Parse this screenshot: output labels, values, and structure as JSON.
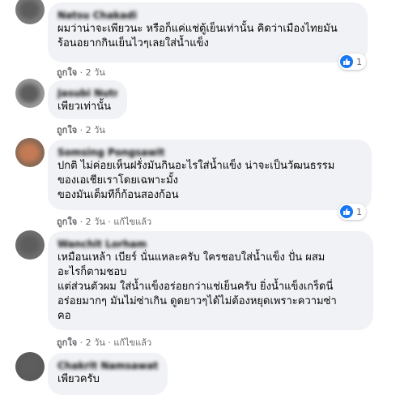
{
  "comments": [
    {
      "author": "Natsu Chakadi",
      "text": "ผมว่าน่าจะเพียวนะ หรือก็แค่แช่ตู้เย็นเท่านั้น คิดว่าเมืองไทยมัน\nร้อนอยากกินเย็นไวๆเลยใส่น้ำแข็ง",
      "like_label": "ถูกใจ",
      "time": "2 วัน",
      "reaction_count": "1"
    },
    {
      "author": "Jasubi Nutno",
      "text": "เพียวเท่านั้น",
      "like_label": "ถูกใจ",
      "time": "2 วัน"
    },
    {
      "author": "Somsing Pongsawit",
      "text": "ปกติ ไม่ค่อยเห็นฝรั่งมันกินอะไรใส่น้ำแข็ง น่าจะเป็นวัฒนธรรม\nของเอเชียเราโดยเฉพาะมั้ง\nของมันเต็มทีก็ก้อนสองก้อน",
      "like_label": "ถูกใจ",
      "time": "2 วัน",
      "edited": "แก้ไขแล้ว",
      "reaction_count": "1"
    },
    {
      "author": "Wanchit Lorham",
      "text": "เหมือนเหล้า เบียร์ นั่นแหละครับ ใครชอบใส่น้ำแข็ง ปั่น ผสม\nอะไรก็ตามชอบ\nแต่ส่วนตัวผม ใส่น้ำแข็งอร่อยกว่าแช่เย็นครับ ยิ่งน้ำแข็งเกร็ดนี่\nอร่อยมากๆ มันไม่ซ่าเกิน ดูดยาวๆได้ไม่ต้องหยุดเพราะความซ่า\nคอ",
      "like_label": "ถูกใจ",
      "time": "2 วัน",
      "edited": "แก้ไขแล้ว"
    },
    {
      "author": "Chakrit Namsawat",
      "text": "เพียวครับ"
    }
  ],
  "separator": "·",
  "like_icon": "thumbs-up-icon",
  "colors": {
    "bubble": "#f0f2f5",
    "meta": "#65676b",
    "like": "#1877f2"
  }
}
